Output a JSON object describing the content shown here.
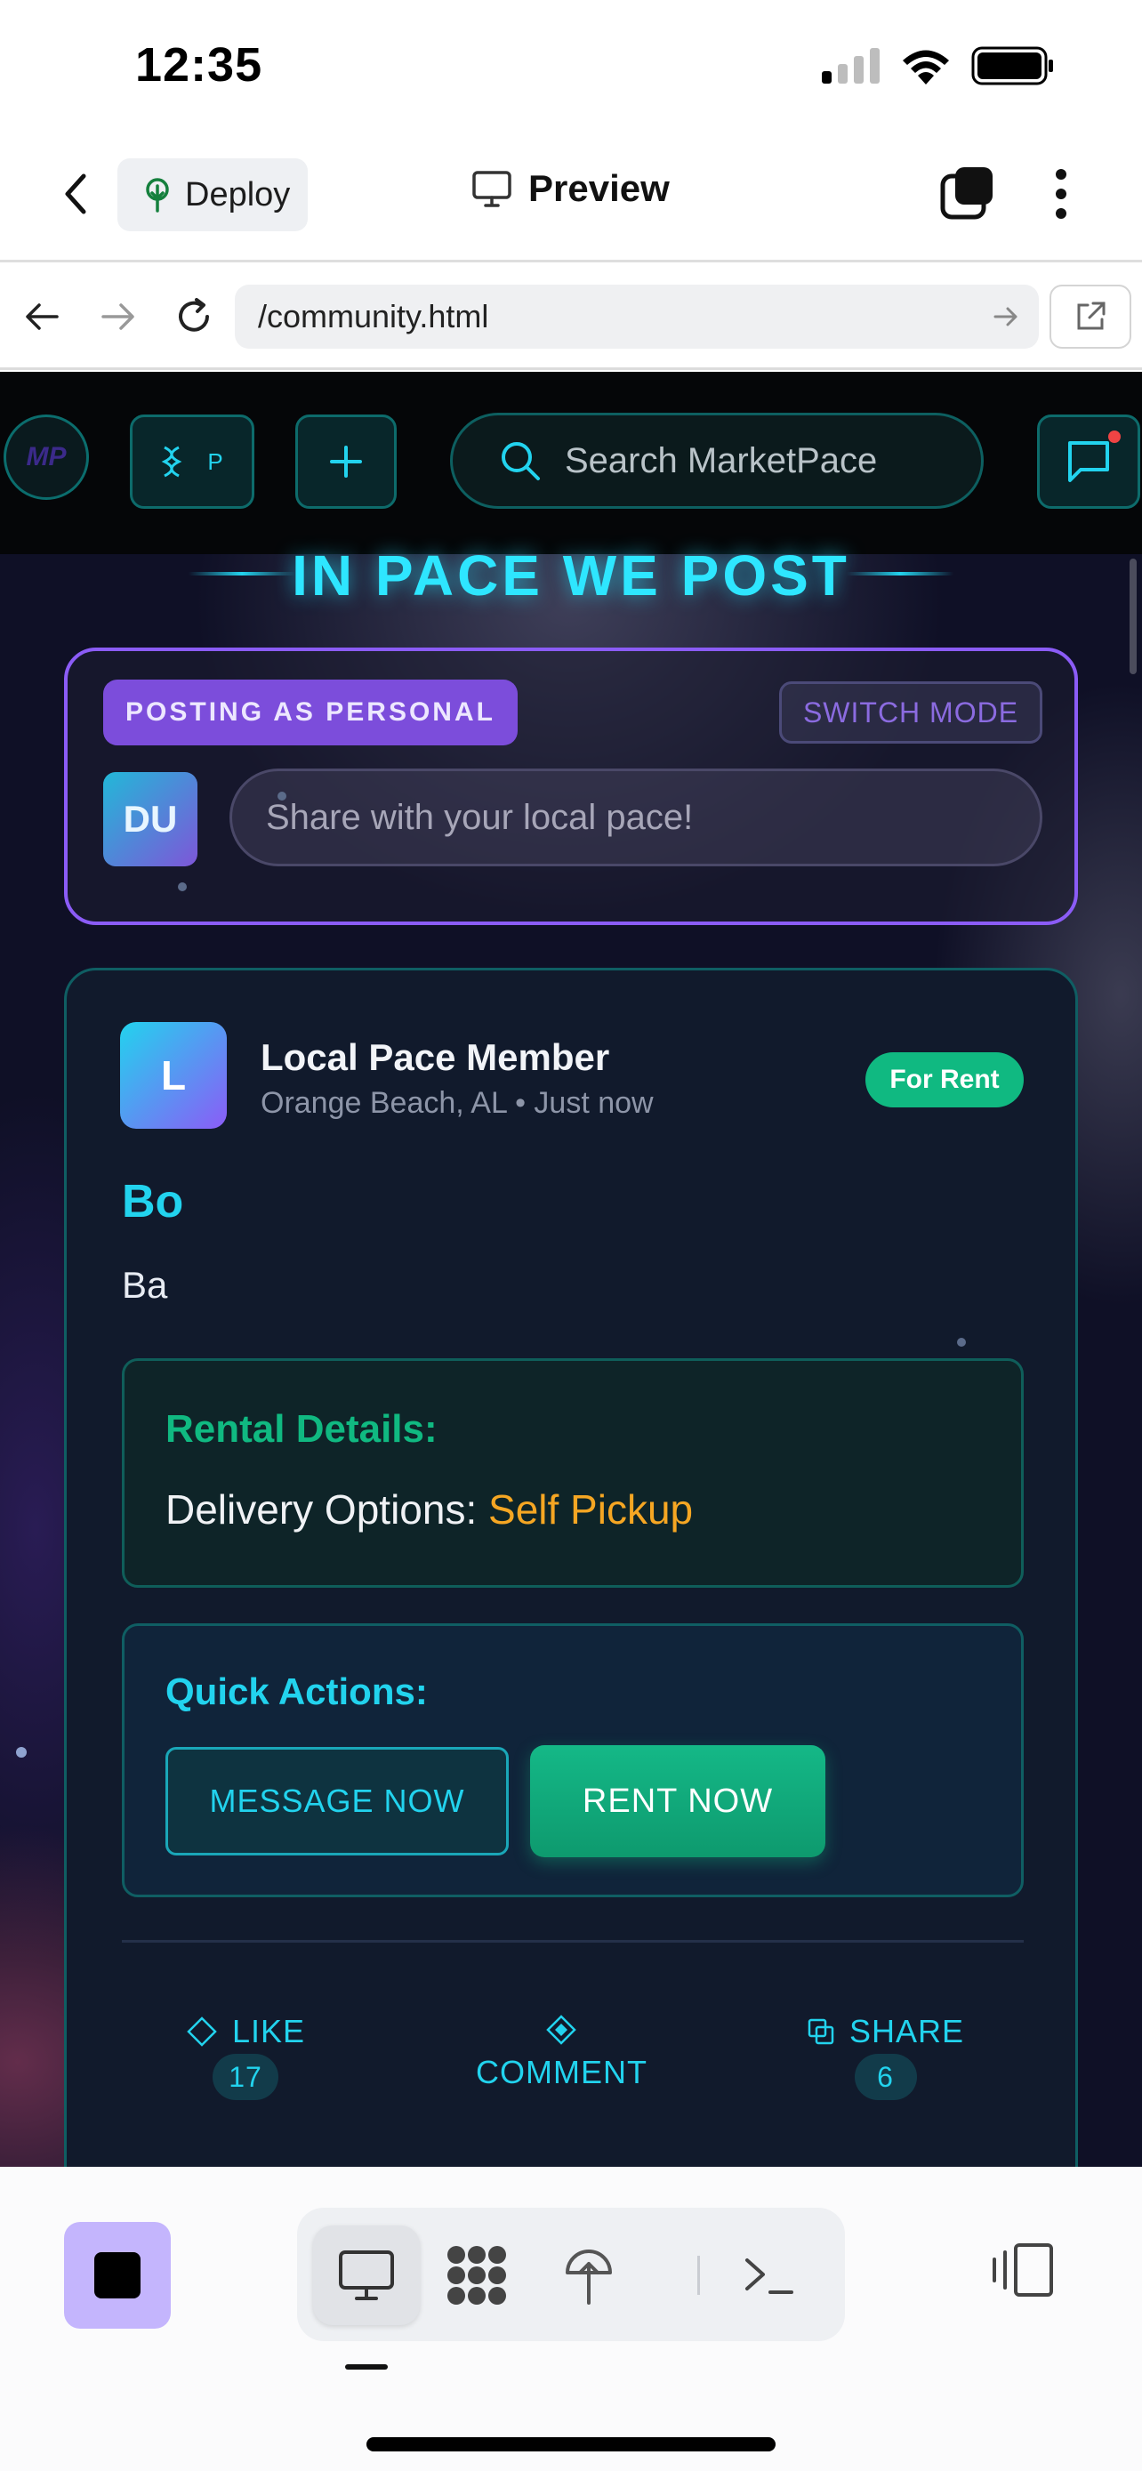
{
  "status_bar": {
    "time": "12:35"
  },
  "app_bar": {
    "deploy_label": "Deploy",
    "preview_label": "Preview"
  },
  "url_bar": {
    "url": "/community.html"
  },
  "site_nav": {
    "logo_text": "MP",
    "box_letter": "P",
    "search_placeholder": "Search MarketPace"
  },
  "hero": {
    "title": "IN PACE WE POST"
  },
  "composer": {
    "posting_as": "POSTING AS PERSONAL",
    "switch_mode": "SWITCH MODE",
    "avatar_initials": "DU",
    "placeholder": "Share with your local pace!"
  },
  "post": {
    "author_initial": "L",
    "author_name": "Local Pace Member",
    "location": "Orange Beach, AL",
    "time": "Just now",
    "badge": "For Rent",
    "title": "Bo",
    "body": "Ba",
    "rental": {
      "heading": "Rental Details:",
      "delivery_label": "Delivery Options:",
      "delivery_value": "Self Pickup"
    },
    "quick_actions": {
      "heading": "Quick Actions:",
      "message_btn": "MESSAGE NOW",
      "rent_btn": "RENT NOW"
    },
    "reactions": {
      "like_label": "LIKE",
      "like_count": "17",
      "comment_label": "COMMENT",
      "share_label": "SHARE",
      "share_count": "6"
    }
  },
  "colors": {
    "accent_cyan": "#22d3ee",
    "accent_purple": "#8b5cf6",
    "accent_green": "#10b981",
    "accent_orange": "#f5a623",
    "stop_button": "#c4b5fd"
  }
}
